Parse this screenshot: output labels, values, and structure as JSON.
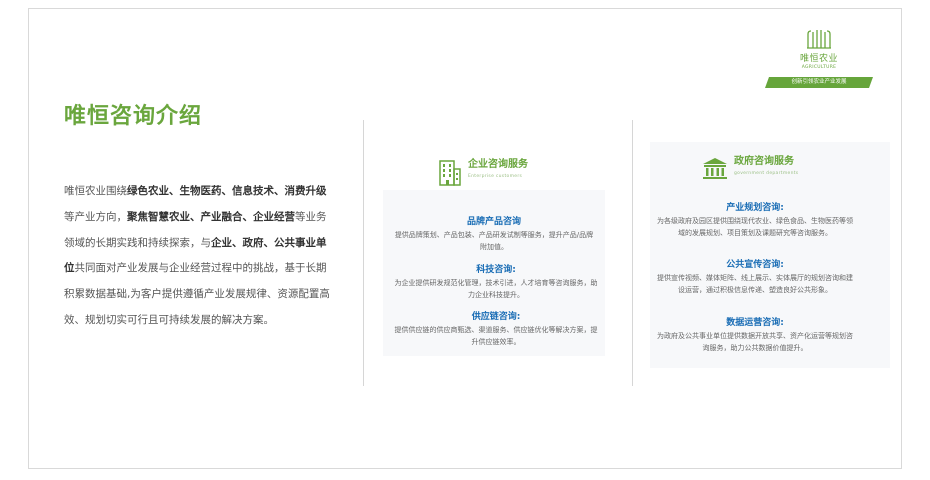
{
  "logo": {
    "name_cn": "唯恒农业",
    "name_en": "AGRICULTURE",
    "slogan": "创新引领农业产业发展"
  },
  "page_title": "唯恒咨询介绍",
  "intro": [
    {
      "text": "唯恒农业围绕",
      "bold": false
    },
    {
      "text": "绿色农业、生物医药、信息技术、消费升级",
      "bold": true
    },
    {
      "text": "等产业方向，",
      "bold": false
    },
    {
      "text": "聚焦智慧农业、产业融合、企业经营",
      "bold": true
    },
    {
      "text": "等业务领域的长期实践和持续探索，与",
      "bold": false
    },
    {
      "text": "企业、政府、公共事业单位",
      "bold": true
    },
    {
      "text": "共同面对产业发展与企业经营过程中的挑战，基于长期积累数据基础,为客户提供遵循产业发展规律、资源配置高效、规划切实可行且可持续发展的解决方案。",
      "bold": false
    }
  ],
  "enterprise": {
    "title_cn": "企业咨询服务",
    "title_en": "Enterprise customers",
    "icon": "building-icon",
    "sections": [
      {
        "title": "品牌产品咨询",
        "body": "提供品牌策划、产品包装、产品研发试制等服务，提升产品/品牌附加值。"
      },
      {
        "title": "科技咨询:",
        "body": "为企业提供研发规范化管理，技术引进，人才培育等咨询服务，助力企业科技提升。"
      },
      {
        "title": "供应链咨询:",
        "body": "提供供应链的供应商甄选、渠道服务、供应链优化等解决方案，提升供应链效率。"
      }
    ]
  },
  "government": {
    "title_cn": "政府咨询服务",
    "title_en": "government departments",
    "icon": "government-building-icon",
    "sections": [
      {
        "title": "产业规划咨询:",
        "body": "为各级政府及园区提供围绕现代农业、绿色食品、生物医药等领域的发展规划、项目策划及课题研究等咨询服务。"
      },
      {
        "title": "公共宣传咨询:",
        "body": "提供宣传视频、媒体矩阵、线上展示、实体展厅的规划咨询和建设运营，通过积极信息传递、塑造良好公共形象。"
      },
      {
        "title": "数据运营咨询:",
        "body": "为政府及公共事业单位提供数据开放共享、资产化运营等规划咨询服务，助力公共数据价值提升。"
      }
    ]
  },
  "colors": {
    "brand_green": "#6aa63d",
    "section_blue": "#1a6db5"
  }
}
